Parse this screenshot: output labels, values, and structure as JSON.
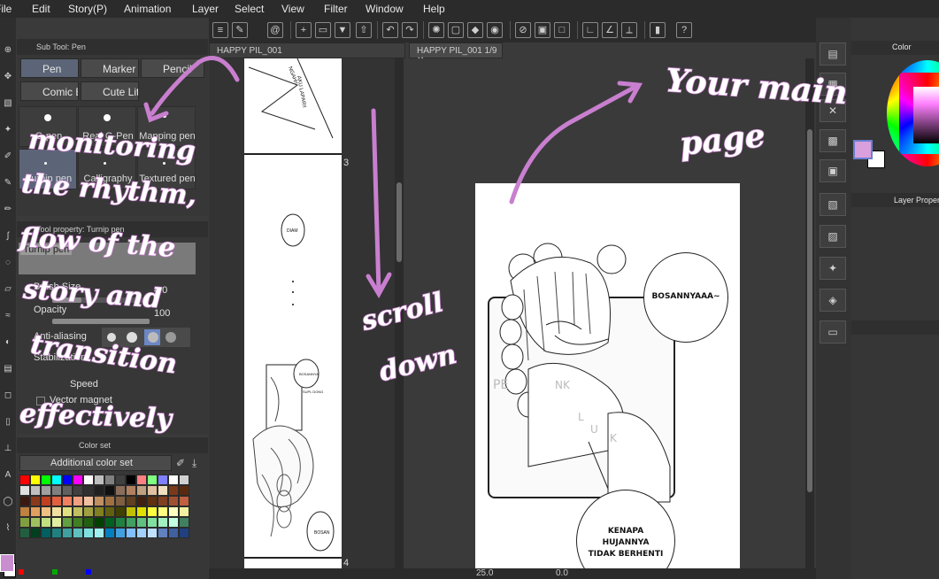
{
  "menu": [
    "File",
    "Edit",
    "Story(P)",
    "Animation",
    "Layer",
    "Select",
    "View",
    "Filter",
    "Window",
    "Help"
  ],
  "subtool": {
    "title": "Sub Tool: Pen",
    "groups": [
      "Pen",
      "Marker",
      "Pencil",
      "Comic Brush",
      "Cute Little"
    ],
    "brushes": [
      "G-pen",
      "Real G-Pen",
      "Mapping pen",
      "Turnip pen",
      "Calligraphy",
      "Textured pen"
    ]
  },
  "toolprop": {
    "title": "Tool property: Turnip pen",
    "tool_name": "Turnip pen",
    "brush_size_label": "Brush Size",
    "brush_size_value": "4.0",
    "opacity_label": "Opacity",
    "opacity_value": "100",
    "opacity_fraction": 1.0,
    "brush_size_fraction": 0.3,
    "antialias_label": "Anti-aliasing",
    "stabilization_label": "Stabilization",
    "speed_label": "Speed",
    "vector_magnet_label": "Vector magnet"
  },
  "colorset": {
    "title": "Color set",
    "selected": "Additional color set",
    "colors": [
      "#ff0000",
      "#ffff00",
      "#00ff00",
      "#00ffff",
      "#0000ff",
      "#ff00ff",
      "#ffffff",
      "#bfbfbf",
      "#808080",
      "#404040",
      "#000000",
      "#ff8080",
      "#80ff80",
      "#8080ff",
      "#ffffff",
      "#d0d0d0",
      "#e0e0e0",
      "#c0c0c0",
      "#a0a0a0",
      "#808080",
      "#606060",
      "#404040",
      "#303030",
      "#202020",
      "#101010",
      "#8a6d5a",
      "#b08060",
      "#c0a080",
      "#e0c0a0",
      "#f0e0c0",
      "#7a3a1a",
      "#5a2a10",
      "#3a1a10",
      "#8a3a1a",
      "#c04020",
      "#e06040",
      "#f08060",
      "#f0a080",
      "#f0c0a0",
      "#c09060",
      "#a07040",
      "#806040",
      "#604020",
      "#402010",
      "#603010",
      "#804020",
      "#a05030",
      "#c06040",
      "#c08040",
      "#e0a060",
      "#f0c080",
      "#f0e0a0",
      "#e0e080",
      "#c0c060",
      "#a0a040",
      "#808020",
      "#606010",
      "#404000",
      "#c0c000",
      "#e0e000",
      "#ffff40",
      "#ffff80",
      "#ffffc0",
      "#f0f0a0",
      "#80a040",
      "#a0c060",
      "#c0e080",
      "#e0f0a0",
      "#60a040",
      "#408020",
      "#206010",
      "#004000",
      "#006020",
      "#208040",
      "#40a060",
      "#60c080",
      "#80e0a0",
      "#a0f0c0",
      "#c0ffe0",
      "#408060",
      "#206040",
      "#004020",
      "#006060",
      "#208080",
      "#40a0a0",
      "#60c0c0",
      "#80e0e0",
      "#a0f0f0",
      "#0080c0",
      "#40a0e0",
      "#80c0ff",
      "#a0d0ff",
      "#c0e0ff",
      "#6080c0",
      "#4060a0",
      "#204080"
    ],
    "bottom_colors": [
      "#ff0000",
      "#00aa00",
      "#0000ff"
    ]
  },
  "tabs": {
    "left": "HAPPY PIL_001",
    "right": "HAPPY PIL_001 1/9"
  },
  "pages": {
    "page3": "3",
    "page4": "4"
  },
  "bubbles": {
    "top": "BOSANNYAAA~",
    "bottom": "KENAPA HUJANNYA TIDAK BERHENTI",
    "thumb_strip_small": "DIAM",
    "thumb_strip_2a": "BOSANNYA",
    "thumb_strip_2b": "SUPL DONG",
    "thumb_strip_3": "BOSAN"
  },
  "sfx": [
    "PE",
    "NK",
    "L",
    "U",
    "K"
  ],
  "manga_top_sfx": [
    "NGAH!!",
    "AKU LAPAR!!"
  ],
  "status": {
    "zoom": "25.0",
    "angle": "0.0"
  },
  "right": {
    "color_tab": "Color",
    "layer_tab": "Layer Property",
    "main_color": "#d9a0dd",
    "sub_color": "#ffffff"
  },
  "annotations": {
    "monitoring": [
      "monitoring",
      "the rhythm,",
      "flow of the",
      "story and",
      "transition",
      "effectively"
    ],
    "scroll": [
      "scroll",
      "down"
    ],
    "your_main_page": [
      "Your main",
      "page"
    ]
  },
  "accent_pink": "#c97fcf"
}
